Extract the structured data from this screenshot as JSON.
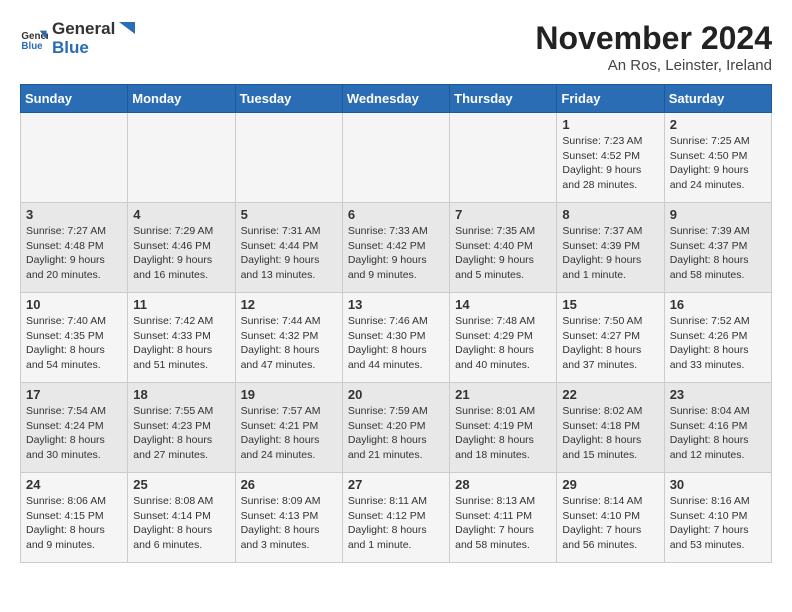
{
  "logo": {
    "text_general": "General",
    "text_blue": "Blue"
  },
  "title": "November 2024",
  "location": "An Ros, Leinster, Ireland",
  "days_of_week": [
    "Sunday",
    "Monday",
    "Tuesday",
    "Wednesday",
    "Thursday",
    "Friday",
    "Saturday"
  ],
  "weeks": [
    [
      {
        "day": "",
        "info": ""
      },
      {
        "day": "",
        "info": ""
      },
      {
        "day": "",
        "info": ""
      },
      {
        "day": "",
        "info": ""
      },
      {
        "day": "",
        "info": ""
      },
      {
        "day": "1",
        "info": "Sunrise: 7:23 AM\nSunset: 4:52 PM\nDaylight: 9 hours and 28 minutes."
      },
      {
        "day": "2",
        "info": "Sunrise: 7:25 AM\nSunset: 4:50 PM\nDaylight: 9 hours and 24 minutes."
      }
    ],
    [
      {
        "day": "3",
        "info": "Sunrise: 7:27 AM\nSunset: 4:48 PM\nDaylight: 9 hours and 20 minutes."
      },
      {
        "day": "4",
        "info": "Sunrise: 7:29 AM\nSunset: 4:46 PM\nDaylight: 9 hours and 16 minutes."
      },
      {
        "day": "5",
        "info": "Sunrise: 7:31 AM\nSunset: 4:44 PM\nDaylight: 9 hours and 13 minutes."
      },
      {
        "day": "6",
        "info": "Sunrise: 7:33 AM\nSunset: 4:42 PM\nDaylight: 9 hours and 9 minutes."
      },
      {
        "day": "7",
        "info": "Sunrise: 7:35 AM\nSunset: 4:40 PM\nDaylight: 9 hours and 5 minutes."
      },
      {
        "day": "8",
        "info": "Sunrise: 7:37 AM\nSunset: 4:39 PM\nDaylight: 9 hours and 1 minute."
      },
      {
        "day": "9",
        "info": "Sunrise: 7:39 AM\nSunset: 4:37 PM\nDaylight: 8 hours and 58 minutes."
      }
    ],
    [
      {
        "day": "10",
        "info": "Sunrise: 7:40 AM\nSunset: 4:35 PM\nDaylight: 8 hours and 54 minutes."
      },
      {
        "day": "11",
        "info": "Sunrise: 7:42 AM\nSunset: 4:33 PM\nDaylight: 8 hours and 51 minutes."
      },
      {
        "day": "12",
        "info": "Sunrise: 7:44 AM\nSunset: 4:32 PM\nDaylight: 8 hours and 47 minutes."
      },
      {
        "day": "13",
        "info": "Sunrise: 7:46 AM\nSunset: 4:30 PM\nDaylight: 8 hours and 44 minutes."
      },
      {
        "day": "14",
        "info": "Sunrise: 7:48 AM\nSunset: 4:29 PM\nDaylight: 8 hours and 40 minutes."
      },
      {
        "day": "15",
        "info": "Sunrise: 7:50 AM\nSunset: 4:27 PM\nDaylight: 8 hours and 37 minutes."
      },
      {
        "day": "16",
        "info": "Sunrise: 7:52 AM\nSunset: 4:26 PM\nDaylight: 8 hours and 33 minutes."
      }
    ],
    [
      {
        "day": "17",
        "info": "Sunrise: 7:54 AM\nSunset: 4:24 PM\nDaylight: 8 hours and 30 minutes."
      },
      {
        "day": "18",
        "info": "Sunrise: 7:55 AM\nSunset: 4:23 PM\nDaylight: 8 hours and 27 minutes."
      },
      {
        "day": "19",
        "info": "Sunrise: 7:57 AM\nSunset: 4:21 PM\nDaylight: 8 hours and 24 minutes."
      },
      {
        "day": "20",
        "info": "Sunrise: 7:59 AM\nSunset: 4:20 PM\nDaylight: 8 hours and 21 minutes."
      },
      {
        "day": "21",
        "info": "Sunrise: 8:01 AM\nSunset: 4:19 PM\nDaylight: 8 hours and 18 minutes."
      },
      {
        "day": "22",
        "info": "Sunrise: 8:02 AM\nSunset: 4:18 PM\nDaylight: 8 hours and 15 minutes."
      },
      {
        "day": "23",
        "info": "Sunrise: 8:04 AM\nSunset: 4:16 PM\nDaylight: 8 hours and 12 minutes."
      }
    ],
    [
      {
        "day": "24",
        "info": "Sunrise: 8:06 AM\nSunset: 4:15 PM\nDaylight: 8 hours and 9 minutes."
      },
      {
        "day": "25",
        "info": "Sunrise: 8:08 AM\nSunset: 4:14 PM\nDaylight: 8 hours and 6 minutes."
      },
      {
        "day": "26",
        "info": "Sunrise: 8:09 AM\nSunset: 4:13 PM\nDaylight: 8 hours and 3 minutes."
      },
      {
        "day": "27",
        "info": "Sunrise: 8:11 AM\nSunset: 4:12 PM\nDaylight: 8 hours and 1 minute."
      },
      {
        "day": "28",
        "info": "Sunrise: 8:13 AM\nSunset: 4:11 PM\nDaylight: 7 hours and 58 minutes."
      },
      {
        "day": "29",
        "info": "Sunrise: 8:14 AM\nSunset: 4:10 PM\nDaylight: 7 hours and 56 minutes."
      },
      {
        "day": "30",
        "info": "Sunrise: 8:16 AM\nSunset: 4:10 PM\nDaylight: 7 hours and 53 minutes."
      }
    ]
  ]
}
